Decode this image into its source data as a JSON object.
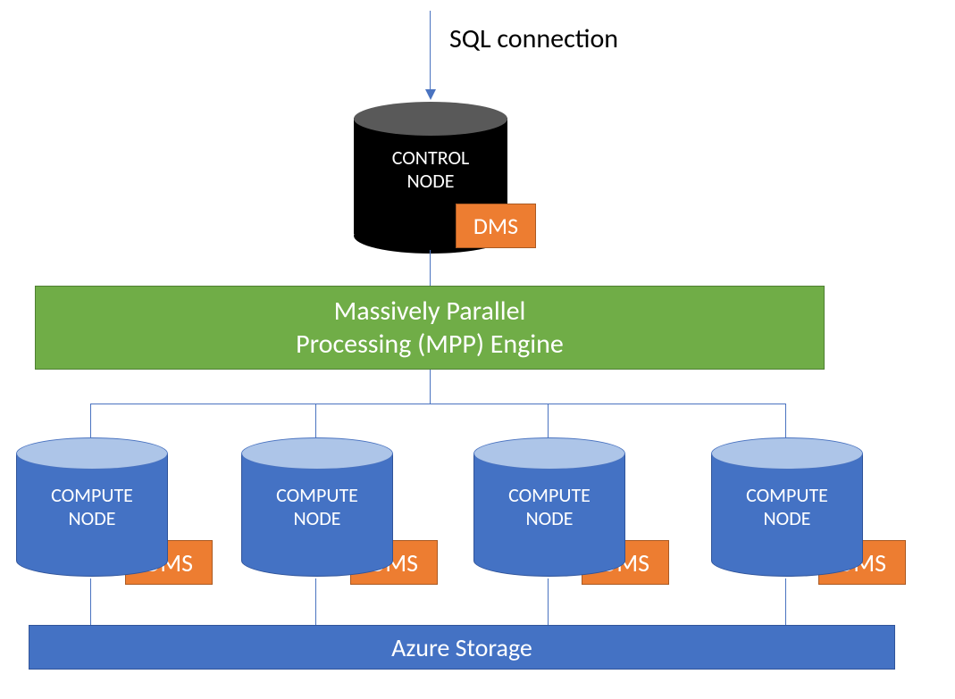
{
  "top_label": "SQL connection",
  "control_node": {
    "label_line1": "CONTROL",
    "label_line2": "NODE",
    "dms_label": "DMS"
  },
  "mpp": {
    "line1": "Massively Parallel",
    "line2": "Processing (MPP) Engine"
  },
  "compute_nodes": [
    {
      "label_line1": "COMPUTE",
      "label_line2": "NODE",
      "dms_label": "DMS"
    },
    {
      "label_line1": "COMPUTE",
      "label_line2": "NODE",
      "dms_label": "DMS"
    },
    {
      "label_line1": "COMPUTE",
      "label_line2": "NODE",
      "dms_label": "DMS"
    },
    {
      "label_line1": "COMPUTE",
      "label_line2": "NODE",
      "dms_label": "DMS"
    }
  ],
  "storage_label": "Azure Storage",
  "colors": {
    "mpp_green": "#70ad47",
    "node_blue": "#4472c4",
    "node_top_blue": "#adc5e8",
    "dms_orange": "#ed7d31",
    "control_black": "#000000",
    "control_top_grey": "#595959",
    "line_blue": "#4a73c0"
  }
}
